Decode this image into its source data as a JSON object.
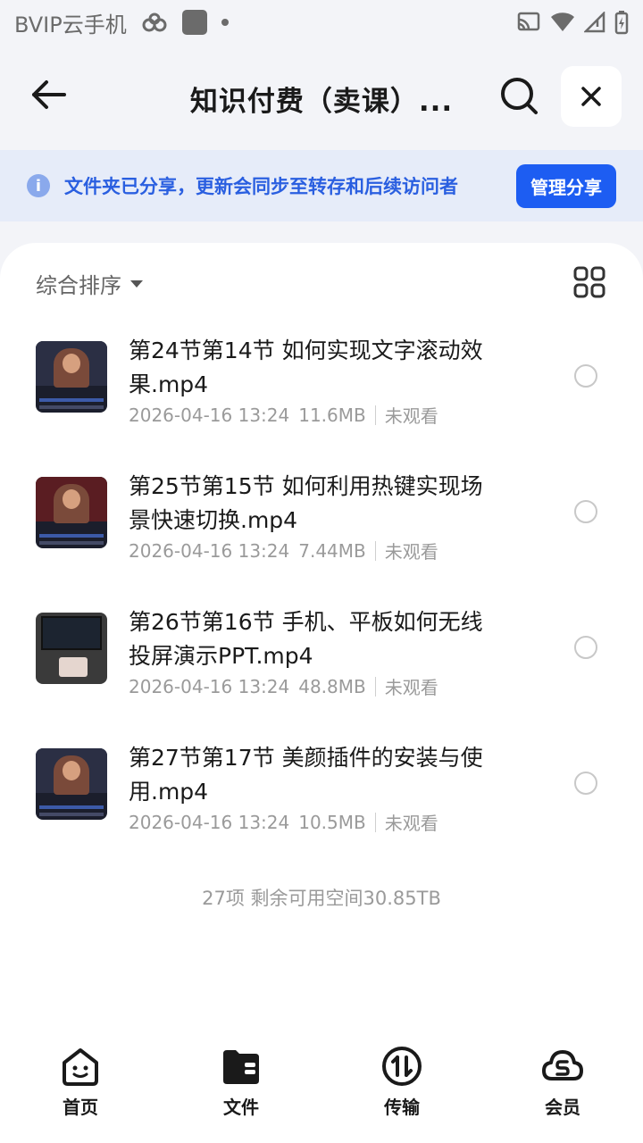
{
  "status_bar": {
    "carrier": "BVIP云手机"
  },
  "header": {
    "title": "知识付费（卖课）..."
  },
  "share_banner": {
    "text": "文件夹已分享，更新会同步至转存和后续访问者",
    "button": "管理分享"
  },
  "sort": {
    "label": "综合排序"
  },
  "files": [
    {
      "name": "第24节第14节 如何实现文字滚动效果.mp4",
      "date": "2026-04-16 13:24",
      "size": "11.6MB",
      "status": "未观看"
    },
    {
      "name": "第25节第15节 如何利用热键实现场景快速切换.mp4",
      "date": "2026-04-16 13:24",
      "size": "7.44MB",
      "status": "未观看"
    },
    {
      "name": "第26节第16节 手机、平板如何无线投屏演示PPT.mp4",
      "date": "2026-04-16 13:24",
      "size": "48.8MB",
      "status": "未观看"
    },
    {
      "name": "第27节第17节 美颜插件的安装与使用.mp4",
      "date": "2026-04-16 13:24",
      "size": "10.5MB",
      "status": "未观看"
    }
  ],
  "footer_info": "27项 剩余可用空间30.85TB",
  "nav": [
    {
      "label": "首页",
      "icon": "home-face-icon"
    },
    {
      "label": "文件",
      "icon": "folder-icon"
    },
    {
      "label": "传输",
      "icon": "transfer-icon"
    },
    {
      "label": "会员",
      "icon": "vip-cloud-icon"
    }
  ]
}
